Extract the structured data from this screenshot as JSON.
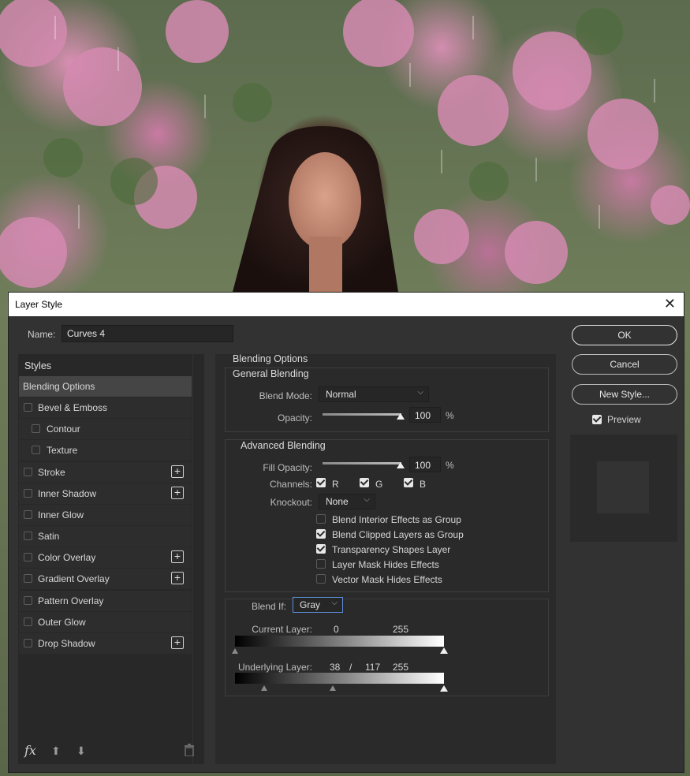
{
  "dialog": {
    "title": "Layer Style",
    "name_label": "Name:",
    "name_value": "Curves 4"
  },
  "styles_panel": {
    "heading": "Styles",
    "items": [
      {
        "label": "Blending Options",
        "selected": true,
        "checkbox": false,
        "add": false
      },
      {
        "label": "Bevel & Emboss",
        "checkbox": true,
        "add": false
      },
      {
        "label": "Contour",
        "checkbox": true,
        "indent": true,
        "add": false
      },
      {
        "label": "Texture",
        "checkbox": true,
        "indent": true,
        "add": false
      },
      {
        "label": "Stroke",
        "checkbox": true,
        "add": true
      },
      {
        "label": "Inner Shadow",
        "checkbox": true,
        "add": true
      },
      {
        "label": "Inner Glow",
        "checkbox": true,
        "add": false
      },
      {
        "label": "Satin",
        "checkbox": true,
        "add": false
      },
      {
        "label": "Color Overlay",
        "checkbox": true,
        "add": true
      },
      {
        "label": "Gradient Overlay",
        "checkbox": true,
        "add": true
      },
      {
        "label": "Pattern Overlay",
        "checkbox": true,
        "add": false
      },
      {
        "label": "Outer Glow",
        "checkbox": true,
        "add": false
      },
      {
        "label": "Drop Shadow",
        "checkbox": true,
        "add": true
      }
    ],
    "fx_label": "fx"
  },
  "blending": {
    "title": "Blending Options",
    "general_title": "General Blending",
    "blend_mode_label": "Blend Mode:",
    "blend_mode_value": "Normal",
    "opacity_label": "Opacity:",
    "opacity_value": "100",
    "opacity_unit": "%",
    "advanced_title": "Advanced Blending",
    "fill_opacity_label": "Fill Opacity:",
    "fill_opacity_value": "100",
    "fill_unit": "%",
    "channels_label": "Channels:",
    "channels": [
      {
        "label": "R",
        "checked": true
      },
      {
        "label": "G",
        "checked": true
      },
      {
        "label": "B",
        "checked": true
      }
    ],
    "knockout_label": "Knockout:",
    "knockout_value": "None",
    "options": [
      {
        "label": "Blend Interior Effects as Group",
        "checked": false
      },
      {
        "label": "Blend Clipped Layers as Group",
        "checked": true
      },
      {
        "label": "Transparency Shapes Layer",
        "checked": true
      },
      {
        "label": "Layer Mask Hides Effects",
        "checked": false
      },
      {
        "label": "Vector Mask Hides Effects",
        "checked": false
      }
    ],
    "blend_if_label": "Blend If:",
    "blend_if_value": "Gray",
    "current_layer_label": "Current Layer:",
    "current_low": "0",
    "current_high": "255",
    "underlying_layer_label": "Underlying Layer:",
    "underlying_low_a": "38",
    "underlying_sep": "/",
    "underlying_low_b": "117",
    "underlying_high": "255"
  },
  "buttons": {
    "ok": "OK",
    "cancel": "Cancel",
    "new_style": "New Style...",
    "preview_label": "Preview",
    "preview_checked": true
  }
}
